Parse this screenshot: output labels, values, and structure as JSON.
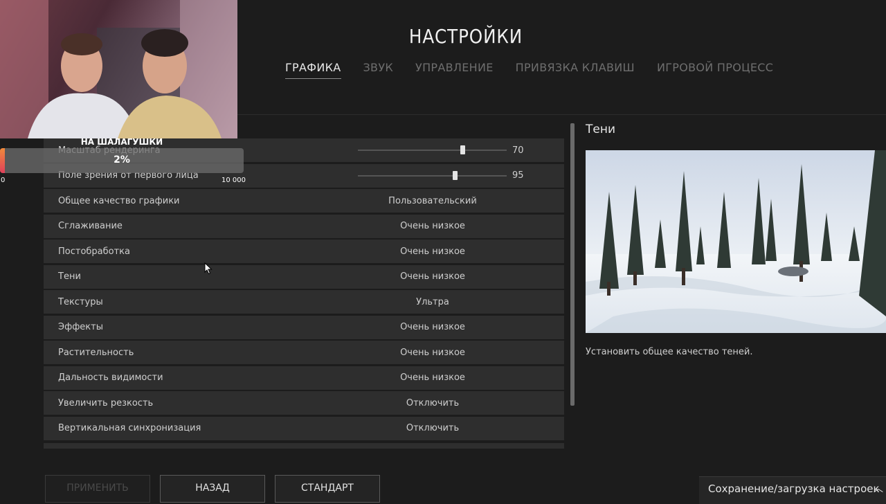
{
  "header": {
    "title": "НАСТРОЙКИ",
    "tabs": [
      {
        "label": "ГРАФИКА",
        "active": true
      },
      {
        "label": "ЗВУК",
        "active": false
      },
      {
        "label": "УПРАВЛЕНИЕ",
        "active": false
      },
      {
        "label": "ПРИВЯЗКА КЛАВИШ",
        "active": false
      },
      {
        "label": "ИГРОВОЙ ПРОЦЕСС",
        "active": false
      }
    ]
  },
  "settings": {
    "sliders": [
      {
        "label": "Масштаб рендеринга",
        "value": "70",
        "min": 0,
        "max": 100
      },
      {
        "label": "Поле зрения от первого лица",
        "value": "95",
        "min": 80,
        "max": 103
      }
    ],
    "rows": [
      {
        "label": "Общее качество графики",
        "value": "Пользовательский"
      },
      {
        "label": "Сглаживание",
        "value": "Очень низкое"
      },
      {
        "label": "Постобработка",
        "value": "Очень низкое"
      },
      {
        "label": "Тени",
        "value": "Очень низкое"
      },
      {
        "label": "Текстуры",
        "value": "Ультра"
      },
      {
        "label": "Эффекты",
        "value": "Очень низкое"
      },
      {
        "label": "Растительность",
        "value": "Очень низкое"
      },
      {
        "label": "Дальность видимости",
        "value": "Очень низкое"
      },
      {
        "label": "Увеличить резкость",
        "value": "Отключить"
      },
      {
        "label": "Вертикальная синхронизация",
        "value": "Отключить"
      }
    ]
  },
  "detail": {
    "title": "Тени",
    "description": "Установить общее качество теней."
  },
  "footer": {
    "apply_label": "ПРИМЕНИТЬ",
    "back_label": "НАЗАД",
    "default_label": "СТАНДАРТ",
    "save_load_label": "Сохранение/загрузка настроек"
  },
  "overlay": {
    "goal_title": "НА ШАЛАГУШКИ",
    "goal_percent": "2%",
    "goal_fraction": 0.02,
    "goal_min": "0",
    "goal_max": "10 000"
  },
  "icons": {
    "cursor": "mouse-pointer-icon",
    "save_load_caret": "chevron-up-icon"
  },
  "colors": {
    "background": "#1c1c1c",
    "row_background": "#2e2e2e",
    "goal_fill_start": "#f08a3c",
    "goal_fill_end": "#e0405a"
  }
}
